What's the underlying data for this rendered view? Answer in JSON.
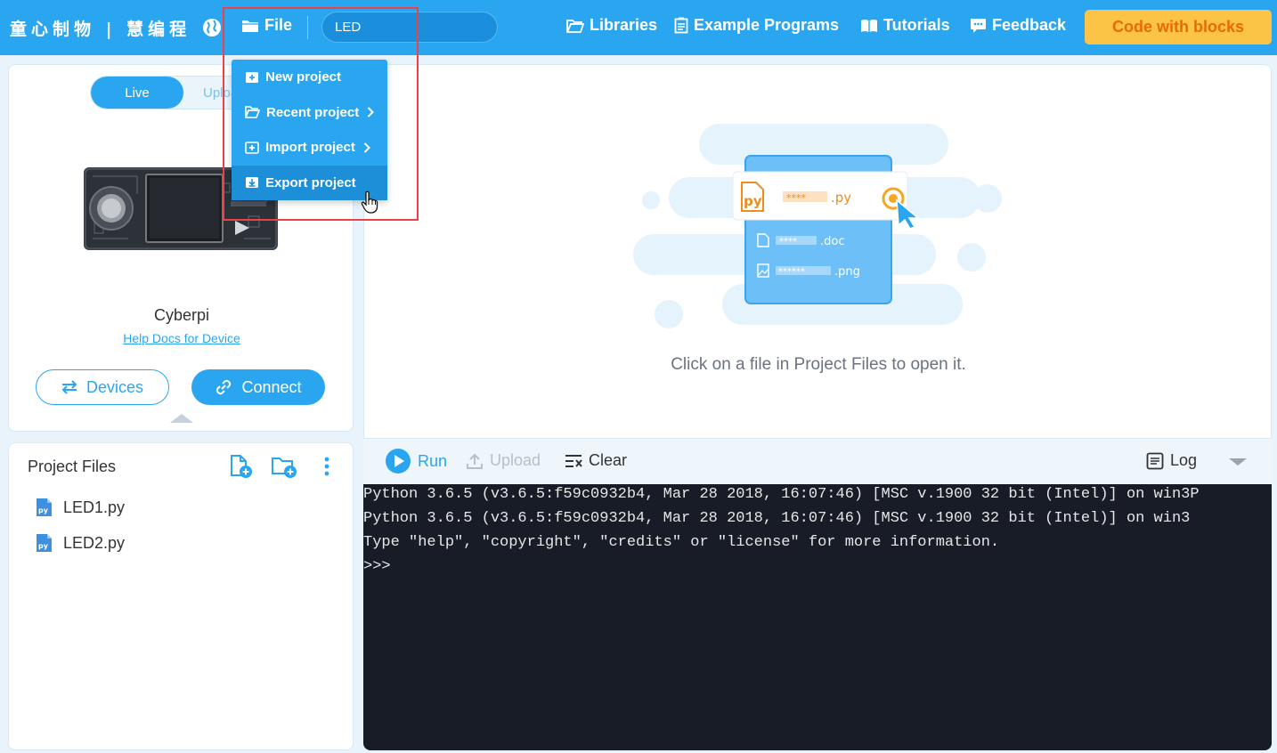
{
  "header": {
    "brand": "童心制物 | 慧编程",
    "file_label": "File",
    "project_name": "LED",
    "nav": {
      "libraries": "Libraries",
      "example_programs": "Example Programs",
      "tutorials": "Tutorials",
      "feedback": "Feedback"
    },
    "code_with_blocks": "Code with blocks"
  },
  "file_menu": {
    "items": [
      {
        "label": "New project",
        "has_submenu": false
      },
      {
        "label": "Recent project",
        "has_submenu": true
      },
      {
        "label": "Import project",
        "has_submenu": true
      },
      {
        "label": "Export project",
        "has_submenu": false,
        "hovered": true
      }
    ]
  },
  "device_panel": {
    "mode_live": "Live",
    "mode_upload": "Upload",
    "device_name": "Cyberpi",
    "help_link": "Help Docs for Device",
    "devices_button": "Devices",
    "connect_button": "Connect"
  },
  "project_files": {
    "title": "Project Files",
    "files": [
      "LED1.py",
      "LED2.py"
    ],
    "file_badge": "py"
  },
  "editor": {
    "hint": "Click on a file in Project Files to open it.",
    "illustration": {
      "main_file_mask": "****",
      "main_file_ext": ".py",
      "badge": "py",
      "doc_mask": "****",
      "doc_ext": ".doc",
      "png_mask": "******",
      "png_ext": ".png"
    }
  },
  "console_toolbar": {
    "run": "Run",
    "upload": "Upload",
    "clear": "Clear",
    "log": "Log"
  },
  "console": {
    "lines": [
      "Python 3.6.5 (v3.6.5:f59c0932b4, Mar 28 2018, 16:07:46) [MSC v.1900 32 bit (Intel)] on win3P",
      "Python 3.6.5 (v3.6.5:f59c0932b4, Mar 28 2018, 16:07:46) [MSC v.1900 32 bit (Intel)] on win3",
      "Type \"help\", \"copyright\", \"credits\" or \"license\" for more information.",
      ">>>"
    ]
  },
  "colors": {
    "primary": "#2aa6f0",
    "accent": "#fbc446",
    "accent_text": "#e96a06",
    "console_bg": "#181c26",
    "highlight": "#e8424a"
  }
}
